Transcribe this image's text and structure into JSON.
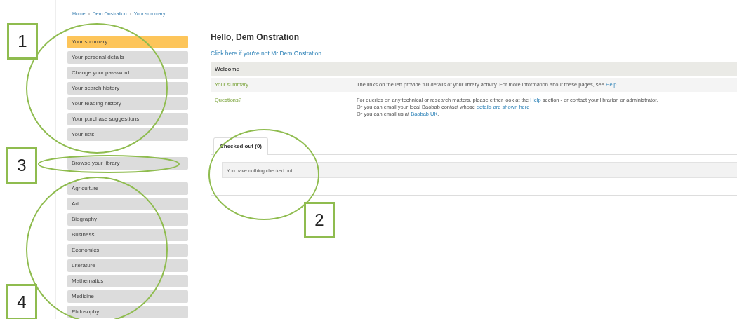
{
  "breadcrumb": [
    "Home",
    "Dem Onstration",
    "Your summary"
  ],
  "sidebar": {
    "account_items": [
      {
        "label": "Your summary",
        "selected": true
      },
      {
        "label": "Your personal details",
        "selected": false
      },
      {
        "label": "Change your password",
        "selected": false
      },
      {
        "label": "Your search history",
        "selected": false
      },
      {
        "label": "Your reading history",
        "selected": false
      },
      {
        "label": "Your purchase suggestions",
        "selected": false
      },
      {
        "label": "Your lists",
        "selected": false
      }
    ],
    "browse_item": {
      "label": "Browse your library",
      "selected": false
    },
    "subjects": [
      {
        "label": "Agriculture",
        "selected": false
      },
      {
        "label": "Art",
        "selected": false
      },
      {
        "label": "Biography",
        "selected": false
      },
      {
        "label": "Business",
        "selected": false
      },
      {
        "label": "Economics",
        "selected": false
      },
      {
        "label": "Literature",
        "selected": false
      },
      {
        "label": "Mathematics",
        "selected": false
      },
      {
        "label": "Medicine",
        "selected": false
      },
      {
        "label": "Philosophy",
        "selected": false
      }
    ]
  },
  "heading": "Hello, Dem Onstration",
  "not_you_link": "Click here if you're not Mr Dem Onstration",
  "welcome_table": {
    "title": "Welcome",
    "rows": [
      {
        "label": "Your summary",
        "lines": [
          [
            {
              "kind": "text",
              "text": "The links on the left provide full details of your library activity. For more information about these pages, see "
            },
            {
              "kind": "link",
              "text": "Help"
            },
            {
              "kind": "text",
              "text": "."
            }
          ]
        ]
      },
      {
        "label": "Questions?",
        "lines": [
          [
            {
              "kind": "text",
              "text": "For queries on any technical or research matters, please either look at the "
            },
            {
              "kind": "link",
              "text": "Help"
            },
            {
              "kind": "text",
              "text": " section - or contact your librarian or administrator."
            }
          ],
          [
            {
              "kind": "text",
              "text": "Or you can email your local Baobab contact whose "
            },
            {
              "kind": "link",
              "text": "details are shown here"
            }
          ],
          [
            {
              "kind": "text",
              "text": "Or you can email us at "
            },
            {
              "kind": "link",
              "text": "Baobab UK"
            },
            {
              "kind": "text",
              "text": "."
            }
          ]
        ]
      }
    ]
  },
  "tabs": [
    {
      "label": "Checked out (0)",
      "selected": true
    }
  ],
  "tab_message": "You have nothing checked out",
  "annotations": [
    {
      "label": "1"
    },
    {
      "label": "2"
    },
    {
      "label": "3"
    },
    {
      "label": "4"
    }
  ]
}
